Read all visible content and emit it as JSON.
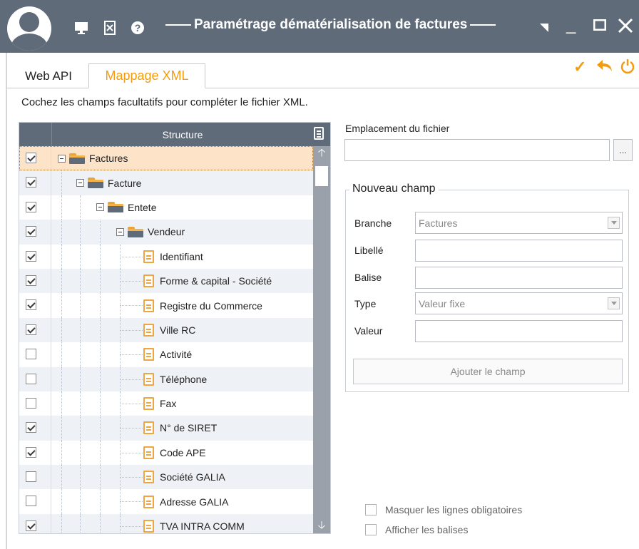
{
  "window": {
    "title": "Paramétrage dématérialisation de factures",
    "icons": [
      "user-avatar-icon",
      "monitor-icon",
      "tool-icon",
      "help-icon",
      "resize-icon",
      "minimize-icon",
      "maximize-icon",
      "close-icon"
    ],
    "controls": {
      "minimize": "_",
      "maximize": "□",
      "close": "✕"
    }
  },
  "actions": {
    "validate": "✓",
    "undo": "↶",
    "power": "⏻"
  },
  "accent_color": "#f39c12",
  "header_color": "#5f6b79",
  "tabs": [
    {
      "label": "Web API",
      "active": false
    },
    {
      "label": "Mappage XML",
      "active": true
    }
  ],
  "instruction": "Cochez les champs facultatifs pour compléter le fichier XML.",
  "tree": {
    "header": "Structure",
    "rows": [
      {
        "label": "Factures",
        "checked": true,
        "type": "folder",
        "level": 0,
        "selected": true
      },
      {
        "label": "Facture",
        "checked": true,
        "type": "folder",
        "level": 1
      },
      {
        "label": "Entete",
        "checked": true,
        "type": "folder",
        "level": 2
      },
      {
        "label": "Vendeur",
        "checked": true,
        "type": "folder",
        "level": 3
      },
      {
        "label": "Identifiant",
        "checked": true,
        "type": "doc",
        "level": 4
      },
      {
        "label": "Forme & capital - Société",
        "checked": true,
        "type": "doc",
        "level": 4
      },
      {
        "label": "Registre du Commerce",
        "checked": true,
        "type": "doc",
        "level": 4
      },
      {
        "label": "Ville RC",
        "checked": true,
        "type": "doc",
        "level": 4
      },
      {
        "label": "Activité",
        "checked": false,
        "type": "doc",
        "level": 4
      },
      {
        "label": "Téléphone",
        "checked": false,
        "type": "doc",
        "level": 4
      },
      {
        "label": "Fax",
        "checked": false,
        "type": "doc",
        "level": 4
      },
      {
        "label": "N° de SIRET",
        "checked": true,
        "type": "doc",
        "level": 4
      },
      {
        "label": "Code APE",
        "checked": true,
        "type": "doc",
        "level": 4
      },
      {
        "label": "Société GALIA",
        "checked": false,
        "type": "doc",
        "level": 4
      },
      {
        "label": "Adresse GALIA",
        "checked": false,
        "type": "doc",
        "level": 4
      },
      {
        "label": "TVA INTRA COMM",
        "checked": true,
        "type": "doc",
        "level": 4
      }
    ]
  },
  "file": {
    "label": "Emplacement du fichier",
    "value": "",
    "browse": "..."
  },
  "new_field": {
    "legend": "Nouveau champ",
    "branche_label": "Branche",
    "branche_value": "Factures",
    "libelle_label": "Libellé",
    "libelle_value": "",
    "balise_label": "Balise",
    "balise_value": "",
    "type_label": "Type",
    "type_value": "Valeur fixe",
    "valeur_label": "Valeur",
    "valeur_value": "",
    "add_button": "Ajouter le champ"
  },
  "options": {
    "hide_required": "Masquer les lignes obligatoires",
    "show_tags": "Afficher les balises"
  }
}
